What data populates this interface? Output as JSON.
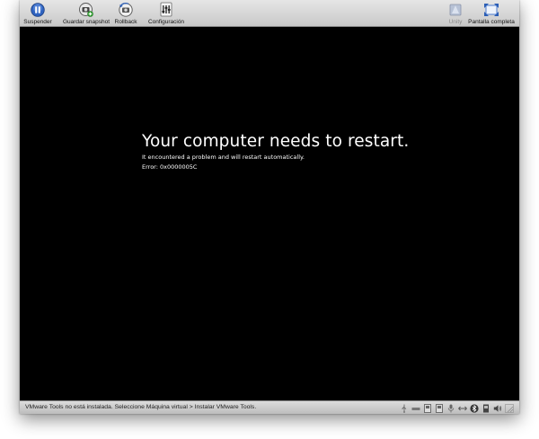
{
  "toolbar": {
    "suspend_label": "Suspender",
    "snapshot_label": "Guardar snapshot",
    "rollback_label": "Rollback",
    "settings_label": "Configuración",
    "unity_label": "Unity",
    "fullscreen_label": "Pantalla completa"
  },
  "screen": {
    "title": "Your computer needs to restart.",
    "message": "It encountered a problem and will restart automatically.",
    "error": "Error: 0x0000005C"
  },
  "status": {
    "message": "VMware Tools no está instalada. Seleccione Máquina virtual > Instalar VMware Tools."
  },
  "icons": {
    "toolbar": [
      "pause-icon",
      "snapshot-camera-icon",
      "rollback-icon",
      "settings-icon",
      "unity-icon",
      "fullscreen-icon"
    ],
    "status": [
      "usb-icon",
      "optical-drive-icon",
      "hard-disk-icon",
      "hard-disk-icon",
      "microphone-icon",
      "network-icon",
      "bluetooth-icon",
      "printer-icon",
      "speaker-icon",
      "resize-icon"
    ]
  },
  "colors": {
    "screen_background": "#000000",
    "screen_text": "#ffffff",
    "accent": "#2a5db5"
  }
}
